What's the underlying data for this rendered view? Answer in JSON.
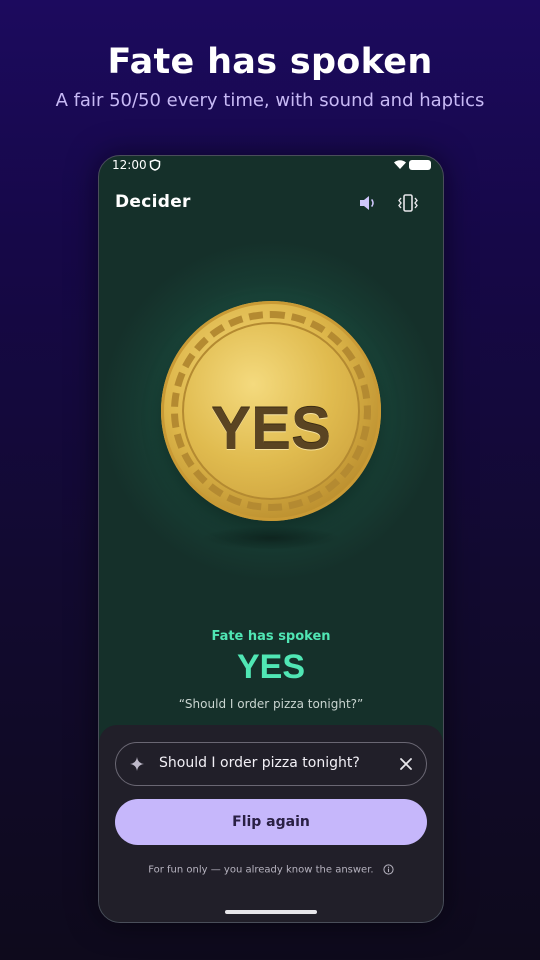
{
  "promo": {
    "headline": "Fate has spoken",
    "subline": "A fair 50/50 every time, with sound and haptics"
  },
  "status_bar": {
    "time": "12:00",
    "icons": [
      "shield-icon",
      "wifi-icon",
      "battery-icon"
    ]
  },
  "app_bar": {
    "title": "Decider",
    "actions": [
      "sound-icon",
      "vibrate-icon"
    ]
  },
  "coin": {
    "face_label": "YES",
    "colors": {
      "gold": "#ddb64a",
      "engraving": "#5a4422"
    }
  },
  "result": {
    "caption": "Fate has spoken",
    "value": "YES",
    "question_quote": "“Should I order pizza tonight?”",
    "accent_color": "#50e6b4"
  },
  "bottom_sheet": {
    "question_value": "Should I order pizza tonight?",
    "flip_button_label": "Flip again",
    "disclaimer": "For fun only — you already know the answer.",
    "button_color": "#c6b7fb"
  }
}
